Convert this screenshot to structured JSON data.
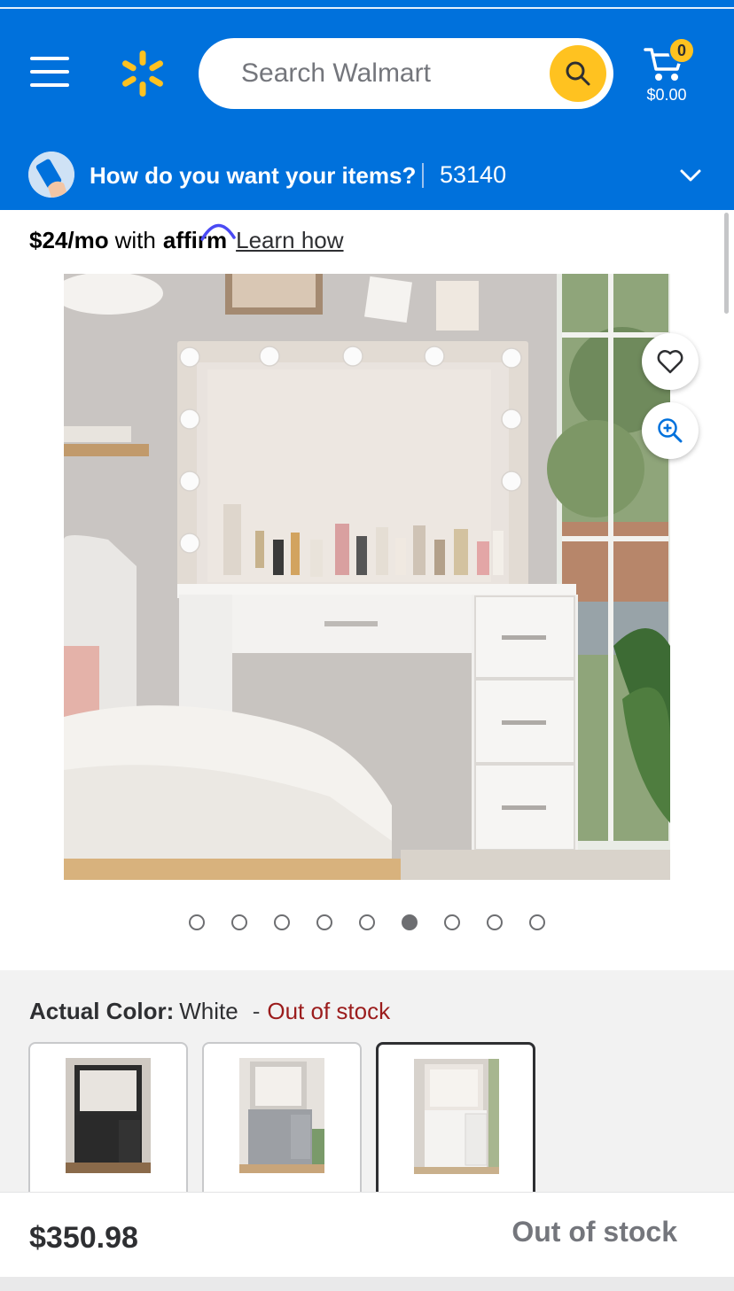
{
  "header": {
    "search_placeholder": "Search Walmart",
    "cart_count": "0",
    "cart_total": "$0.00",
    "fulfillment_prompt": "How do you want your items?",
    "zip": "53140"
  },
  "affirm": {
    "price": "$24/mo",
    "with": "with",
    "brand": "affirm",
    "learn_link": "Learn how"
  },
  "gallery": {
    "total_images": 9,
    "active_index": 5
  },
  "variant": {
    "label": "Actual Color:",
    "value": "White",
    "separator": "-",
    "status": "Out of stock",
    "swatches": [
      {
        "color": "black",
        "selected": false
      },
      {
        "color": "gray",
        "selected": false
      },
      {
        "color": "white",
        "selected": true
      }
    ]
  },
  "bottom": {
    "price": "$350.98",
    "status": "Out of stock"
  },
  "colors": {
    "brand_blue": "#0071dc",
    "spark_yellow": "#ffc220",
    "out_of_stock_red": "#9b1c1c"
  }
}
